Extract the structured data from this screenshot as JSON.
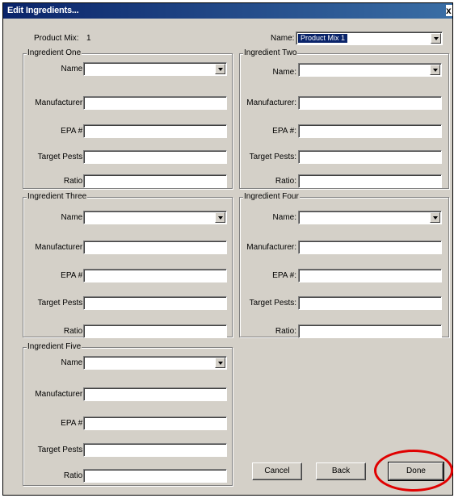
{
  "window": {
    "title": "Edit Ingredients...",
    "close_label": "x"
  },
  "product": {
    "label": "Product Mix:",
    "value": "1",
    "name_label": "Name:",
    "name_value": "Product Mix 1"
  },
  "field_labels": {
    "name": "Name:",
    "manufacturer": "Manufacturer:",
    "epa": "EPA #:",
    "target_pests": "Target Pests:",
    "ratio": "Ratio:"
  },
  "ingredients": [
    {
      "title": "Ingredient One"
    },
    {
      "title": "Ingredient Two"
    },
    {
      "title": "Ingredient Three"
    },
    {
      "title": "Ingredient Four"
    },
    {
      "title": "Ingredient Five"
    }
  ],
  "buttons": {
    "cancel": "Cancel",
    "back": "Back",
    "done": "Done"
  },
  "annotation_color": "#e00000"
}
